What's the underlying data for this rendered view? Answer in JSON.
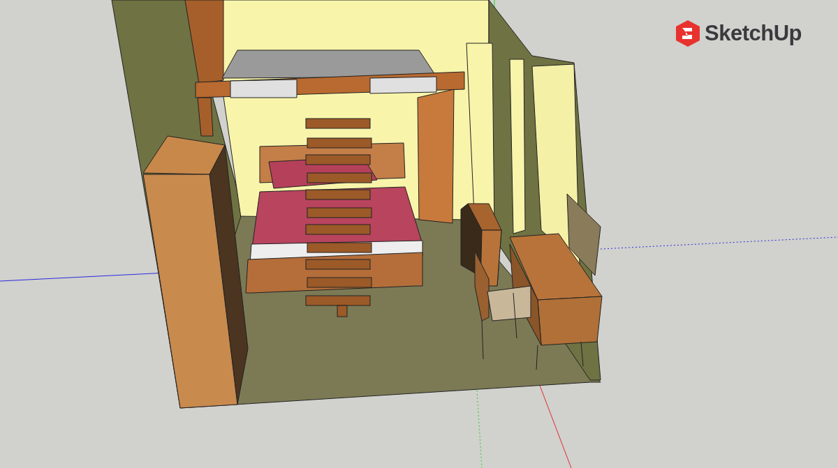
{
  "viewport": {
    "logo": {
      "text": "SketchUp"
    }
  }
}
